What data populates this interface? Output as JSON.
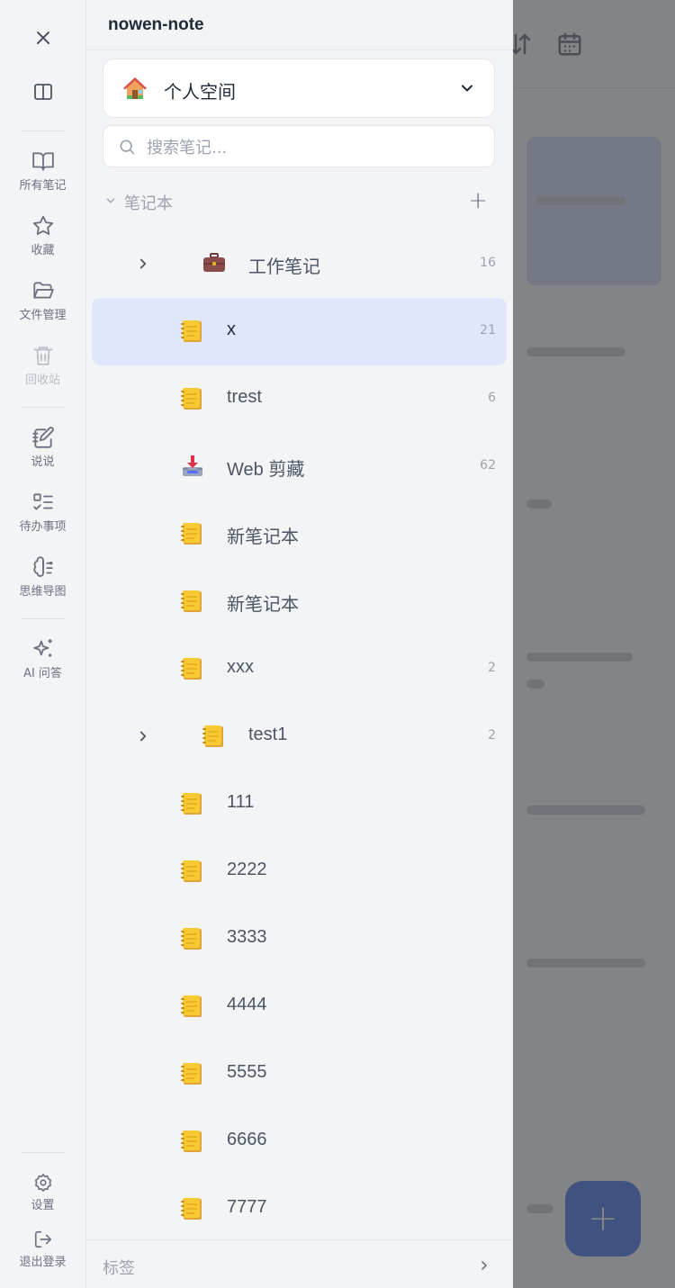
{
  "app": {
    "title": "nowen-note"
  },
  "rail": {
    "close_label": "",
    "items": [
      {
        "id": "all-notes",
        "label": "所有笔记",
        "icon": "book-open-icon",
        "enabled": true
      },
      {
        "id": "favorites",
        "label": "收藏",
        "icon": "star-icon",
        "enabled": true
      },
      {
        "id": "files",
        "label": "文件管理",
        "icon": "folder-open-icon",
        "enabled": true
      },
      {
        "id": "trash",
        "label": "回收站",
        "icon": "trash-icon",
        "enabled": false
      },
      {
        "id": "moments",
        "label": "说说",
        "icon": "notepad-pen-icon",
        "enabled": true
      },
      {
        "id": "todo",
        "label": "待办事项",
        "icon": "checklist-icon",
        "enabled": true
      },
      {
        "id": "mindmap",
        "label": "思维导图",
        "icon": "brain-icon",
        "enabled": true
      },
      {
        "id": "ai",
        "label": "AI 问答",
        "icon": "sparkles-icon",
        "enabled": true
      },
      {
        "id": "settings",
        "label": "设置",
        "icon": "gear-icon",
        "enabled": true
      },
      {
        "id": "logout",
        "label": "退出登录",
        "icon": "logout-icon",
        "enabled": true
      }
    ]
  },
  "workspace": {
    "emoji": "🏠",
    "name": "个人空间"
  },
  "search": {
    "placeholder": "搜索笔记..."
  },
  "notebooks_section": {
    "title": "笔记本",
    "add_label": "+"
  },
  "notebooks": [
    {
      "name": "工作笔记",
      "count": "16",
      "icon": "briefcase-icon",
      "expandable": true,
      "active": false
    },
    {
      "name": "x",
      "count": "21",
      "icon": "notebook-icon",
      "expandable": false,
      "active": true
    },
    {
      "name": "trest",
      "count": "6",
      "icon": "notebook-icon",
      "expandable": false,
      "active": false
    },
    {
      "name": "Web 剪藏",
      "count": "62",
      "icon": "inbox-tray-icon",
      "expandable": false,
      "active": false
    },
    {
      "name": "新笔记本",
      "count": "",
      "icon": "notebook-icon",
      "expandable": false,
      "active": false
    },
    {
      "name": "新笔记本",
      "count": "",
      "icon": "notebook-icon",
      "expandable": false,
      "active": false
    },
    {
      "name": "xxx",
      "count": "2",
      "icon": "notebook-icon",
      "expandable": false,
      "active": false
    },
    {
      "name": "test1",
      "count": "2",
      "icon": "notebook-icon",
      "expandable": true,
      "active": false
    },
    {
      "name": "111",
      "count": "",
      "icon": "notebook-icon",
      "expandable": false,
      "active": false
    },
    {
      "name": "2222",
      "count": "",
      "icon": "notebook-icon",
      "expandable": false,
      "active": false
    },
    {
      "name": "3333",
      "count": "",
      "icon": "notebook-icon",
      "expandable": false,
      "active": false
    },
    {
      "name": "4444",
      "count": "",
      "icon": "notebook-icon",
      "expandable": false,
      "active": false
    },
    {
      "name": "5555",
      "count": "",
      "icon": "notebook-icon",
      "expandable": false,
      "active": false
    },
    {
      "name": "6666",
      "count": "",
      "icon": "notebook-icon",
      "expandable": false,
      "active": false
    },
    {
      "name": "7777",
      "count": "",
      "icon": "notebook-icon",
      "expandable": false,
      "active": false
    }
  ],
  "tags_section": {
    "title": "标签"
  },
  "background": {
    "fab_label": "+"
  },
  "colors": {
    "accent": "#4f7df0",
    "active_row": "#e0e7fd",
    "panel_bg": "#f3f4f6",
    "notebook_yellow": "#f7c933"
  }
}
